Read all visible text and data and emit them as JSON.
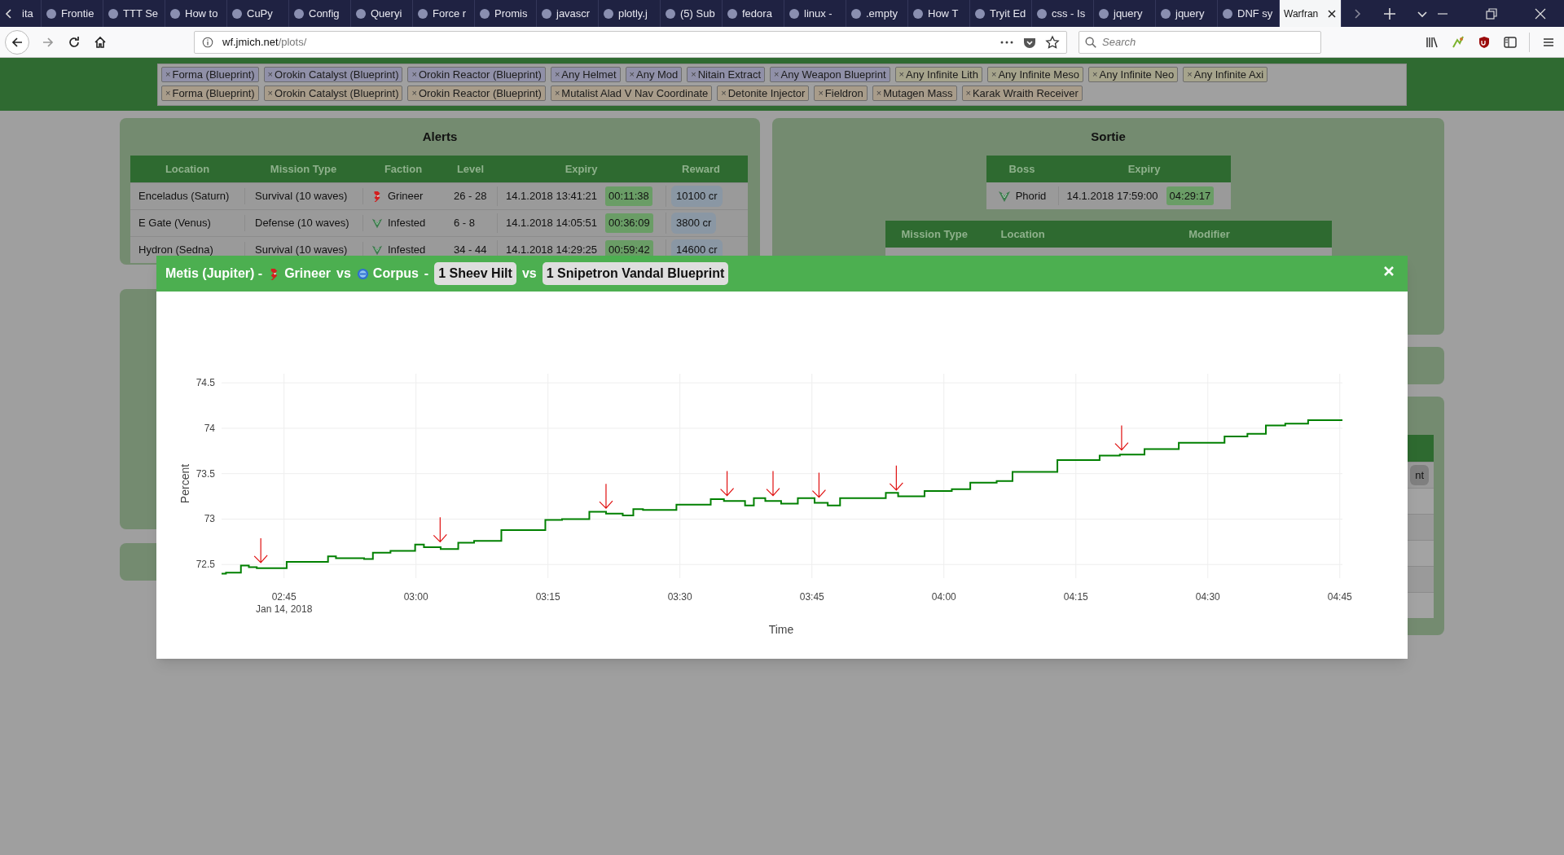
{
  "browser": {
    "tabs": [
      {
        "title": "ita",
        "selected": false
      },
      {
        "title": "Frontie",
        "selected": false
      },
      {
        "title": "TTT Se",
        "selected": false
      },
      {
        "title": "How to",
        "selected": false
      },
      {
        "title": "CuPy",
        "selected": false
      },
      {
        "title": "Config",
        "selected": false
      },
      {
        "title": "Queryi",
        "selected": false
      },
      {
        "title": "Force r",
        "selected": false
      },
      {
        "title": "Promis",
        "selected": false
      },
      {
        "title": "javascr",
        "selected": false
      },
      {
        "title": "plotly.j",
        "selected": false
      },
      {
        "title": "(5) Sub",
        "selected": false
      },
      {
        "title": "fedora",
        "selected": false
      },
      {
        "title": "linux -",
        "selected": false
      },
      {
        "title": ".empty",
        "selected": false
      },
      {
        "title": "How T",
        "selected": false
      },
      {
        "title": "Tryit Ed",
        "selected": false
      },
      {
        "title": "css - Is",
        "selected": false
      },
      {
        "title": "jquery",
        "selected": false
      },
      {
        "title": "jquery",
        "selected": false
      },
      {
        "title": "DNF sy",
        "selected": false
      },
      {
        "title": "Warfran",
        "selected": true
      }
    ],
    "url": {
      "host": "wf.jmich.net",
      "path": "/plots/"
    },
    "search": {
      "placeholder": "Search"
    }
  },
  "filters": {
    "first_line": [
      {
        "remove": "×",
        "label": "Forma (Blueprint)",
        "color": "#9090a8"
      },
      {
        "remove": "×",
        "label": "Orokin Catalyst (Blueprint)",
        "color": "#9090a8"
      },
      {
        "remove": "×",
        "label": "Orokin Reactor (Blueprint)",
        "color": "#9090a8"
      },
      {
        "remove": "×",
        "label": "Any Helmet",
        "color": "#9090a8"
      },
      {
        "remove": "×",
        "label": "Any Mod",
        "color": "#9090a8"
      },
      {
        "remove": "×",
        "label": "Nitain Extract",
        "color": "#9090a8"
      },
      {
        "remove": "×",
        "label": "Any Weapon Blueprint",
        "color": "#9090a8"
      },
      {
        "remove": "×",
        "label": "Any Infinite Lith",
        "color": "#a6a48c"
      },
      {
        "remove": "×",
        "label": "Any Infinite Meso",
        "color": "#a6a48c"
      },
      {
        "remove": "×",
        "label": "Any Infinite Neo",
        "color": "#a6a48c"
      },
      {
        "remove": "×",
        "label": "Any Infinite Axi",
        "color": "#a6a48c"
      }
    ],
    "second_line": [
      {
        "remove": "×",
        "label": "Forma (Blueprint)",
        "color": "#a89c8a"
      },
      {
        "remove": "×",
        "label": "Orokin Catalyst (Blueprint)",
        "color": "#a89c8a"
      },
      {
        "remove": "×",
        "label": "Orokin Reactor (Blueprint)",
        "color": "#a89c8a"
      },
      {
        "remove": "×",
        "label": "Mutalist Alad V Nav Coordinate",
        "color": "#a89c8a"
      },
      {
        "remove": "×",
        "label": "Detonite Injector",
        "color": "#a89c8a"
      },
      {
        "remove": "×",
        "label": "Fieldron",
        "color": "#a89c8a"
      },
      {
        "remove": "×",
        "label": "Mutagen Mass",
        "color": "#a89c8a"
      },
      {
        "remove": "×",
        "label": "Karak Wraith Receiver",
        "color": "#a89c8a"
      }
    ]
  },
  "alerts": {
    "title": "Alerts",
    "columns": [
      "Location",
      "Mission Type",
      "Faction",
      "Level",
      "Expiry",
      "Reward"
    ],
    "rows": [
      {
        "location": "Enceladus (Saturn)",
        "mission_type": "Survival (10 waves)",
        "faction": "Grineer",
        "kind": "grineer",
        "level": "26 - 28",
        "expiry": "14.1.2018 13:41:21",
        "countdown": "00:11:38",
        "reward": "10100 cr"
      },
      {
        "location": "E Gate (Venus)",
        "mission_type": "Defense (10 waves)",
        "faction": "Infested",
        "kind": "infested",
        "level": "6 - 8",
        "expiry": "14.1.2018 14:05:51",
        "countdown": "00:36:09",
        "reward": "3800 cr"
      },
      {
        "location": "Hydron (Sedna)",
        "mission_type": "Survival (10 waves)",
        "faction": "Infested",
        "kind": "infested",
        "level": "34 - 44",
        "expiry": "14.1.2018 14:29:25",
        "countdown": "00:59:42",
        "reward": "14600 cr"
      }
    ]
  },
  "sortie": {
    "title": "Sortie",
    "boss_table": {
      "columns": [
        "Boss",
        "Expiry"
      ],
      "rows": [
        {
          "boss": "Phorid",
          "kind": "infested",
          "expiry": "14.1.2018 17:59:00",
          "countdown": "04:29:17"
        }
      ]
    },
    "missions_table": {
      "columns": [
        "Mission Type",
        "Location",
        "Modifier"
      ]
    }
  },
  "side_table": {
    "badge": "nt"
  },
  "modal": {
    "header": [
      {
        "kind": "text",
        "text": "Metis (Jupiter) -"
      },
      {
        "kind": "grineer",
        "text": "Grineer"
      },
      {
        "kind": "text",
        "text": "vs"
      },
      {
        "kind": "corpus",
        "text": "Corpus"
      },
      {
        "kind": "text",
        "text": "-"
      },
      {
        "kind": "reward",
        "text": "1 Sheev Hilt"
      },
      {
        "kind": "text",
        "text": "vs"
      },
      {
        "kind": "reward",
        "text": "1 Snipetron Vandal Blueprint"
      }
    ],
    "date_label": "Jan 14, 2018",
    "chart_data": {
      "type": "line",
      "xlabel": "Time",
      "ylabel": "Percent",
      "grid": true,
      "x": [
        157.9,
        158.4,
        158.4,
        160.1,
        160.1,
        161.0,
        161.0,
        161.9,
        161.9,
        165.3,
        165.3,
        170.0,
        170.0,
        170.9,
        170.9,
        174.1,
        174.1,
        175.1,
        175.1,
        177.1,
        177.1,
        179.9,
        179.9,
        180.9,
        180.9,
        182.8,
        182.8,
        184.8,
        184.8,
        186.6,
        186.6,
        189.7,
        189.7,
        194.7,
        194.7,
        196.6,
        196.6,
        199.7,
        199.7,
        201.6,
        201.6,
        203.5,
        203.5,
        204.7,
        204.7,
        205.8,
        205.8,
        209.6,
        209.6,
        213.5,
        213.5,
        215.0,
        215.0,
        217.4,
        217.4,
        218.4,
        218.4,
        219.7,
        219.7,
        221.5,
        221.5,
        223.4,
        223.4,
        225.3,
        225.3,
        226.8,
        226.8,
        228.2,
        228.2,
        233.4,
        233.4,
        234.8,
        234.8,
        237.8,
        237.8,
        240.9,
        240.9,
        243.0,
        243.0,
        246.0,
        246.0,
        247.8,
        247.8,
        252.9,
        252.9,
        257.7,
        257.7,
        260.0,
        260.0,
        262.8,
        262.8,
        266.7,
        266.7,
        271.9,
        271.9,
        274.5,
        274.5,
        276.6,
        276.6,
        278.8,
        278.8,
        281.4,
        281.4,
        285.3
      ],
      "series": [
        {
          "color": "#008000",
          "values": [
            72.4,
            72.4,
            72.41,
            72.41,
            72.49,
            72.49,
            72.47,
            72.47,
            72.46,
            72.46,
            72.53,
            72.53,
            72.59,
            72.59,
            72.57,
            72.57,
            72.56,
            72.56,
            72.63,
            72.63,
            72.65,
            72.65,
            72.72,
            72.72,
            72.69,
            72.69,
            72.67,
            72.67,
            72.74,
            72.74,
            72.76,
            72.76,
            72.88,
            72.88,
            72.99,
            72.99,
            73.0,
            73.0,
            73.08,
            73.08,
            73.06,
            73.06,
            73.04,
            73.04,
            73.11,
            73.11,
            73.1,
            73.1,
            73.16,
            73.16,
            73.22,
            73.22,
            73.2,
            73.2,
            73.15,
            73.15,
            73.23,
            73.23,
            73.2,
            73.2,
            73.17,
            73.17,
            73.23,
            73.23,
            73.18,
            73.18,
            73.15,
            73.15,
            73.23,
            73.23,
            73.29,
            73.29,
            73.25,
            73.25,
            73.31,
            73.31,
            73.33,
            73.33,
            73.4,
            73.4,
            73.42,
            73.42,
            73.52,
            73.52,
            73.65,
            73.65,
            73.7,
            73.7,
            73.71,
            73.71,
            73.77,
            73.77,
            73.84,
            73.84,
            73.91,
            73.91,
            73.94,
            73.94,
            74.03,
            74.03,
            74.05,
            74.05,
            74.09,
            74.09
          ]
        }
      ],
      "xlim": [
        157.9,
        285.3
      ],
      "ylim": [
        72.35,
        74.6
      ],
      "xticks": [
        {
          "value": 165,
          "label": "02:45"
        },
        {
          "value": 180,
          "label": "03:00"
        },
        {
          "value": 195,
          "label": "03:15"
        },
        {
          "value": 210,
          "label": "03:30"
        },
        {
          "value": 225,
          "label": "03:45"
        },
        {
          "value": 240,
          "label": "04:00"
        },
        {
          "value": 255,
          "label": "04:15"
        },
        {
          "value": 270,
          "label": "04:30"
        },
        {
          "value": 285,
          "label": "04:45"
        }
      ],
      "yticks": [
        72.5,
        73,
        73.5,
        74,
        74.5
      ]
    }
  }
}
